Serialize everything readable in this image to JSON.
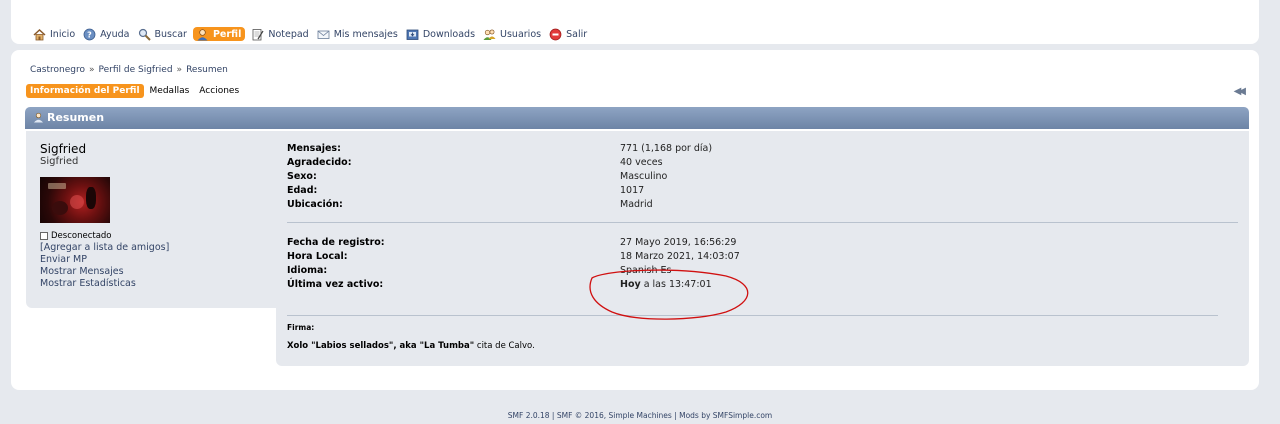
{
  "menu": {
    "items": [
      {
        "label": "Inicio",
        "icon": "home-icon"
      },
      {
        "label": "Ayuda",
        "icon": "help-icon"
      },
      {
        "label": "Buscar",
        "icon": "search-icon"
      },
      {
        "label": "Perfil",
        "icon": "profile-icon",
        "active": true
      },
      {
        "label": "Notepad",
        "icon": "notepad-icon"
      },
      {
        "label": "Mis mensajes",
        "icon": "mail-icon"
      },
      {
        "label": "Downloads",
        "icon": "downloads-icon"
      },
      {
        "label": "Usuarios",
        "icon": "users-icon"
      },
      {
        "label": "Salir",
        "icon": "logout-icon"
      }
    ]
  },
  "breadcrumb": {
    "items": [
      "Castronegro",
      "Perfil de Sigfried",
      "Resumen"
    ],
    "separator": "»"
  },
  "tabs": {
    "items": [
      "Información del Perfil",
      "Medallas",
      "Acciones"
    ],
    "collapse": "◀◀"
  },
  "section": {
    "title": "Resumen"
  },
  "profile": {
    "name": "Sigfried",
    "title": "Sigfried",
    "status": "Desconectado",
    "links": [
      "[Agregar a lista de amigos]",
      "Enviar MP",
      "Mostrar Mensajes",
      "Mostrar Estadísticas"
    ]
  },
  "details": {
    "group1": [
      {
        "label": "Mensajes:",
        "value": "771 (1,168 por día)"
      },
      {
        "label": "Agradecido:",
        "value": "40 veces"
      },
      {
        "label": "Sexo:",
        "value": "Masculino"
      },
      {
        "label": "Edad:",
        "value": "1017"
      },
      {
        "label": "Ubicación:",
        "value": "Madrid"
      }
    ],
    "group2": [
      {
        "label": "Fecha de registro:",
        "value": "27 Mayo 2019, 16:56:29"
      },
      {
        "label": "Hora Local:",
        "value": "18 Marzo 2021, 14:03:07"
      },
      {
        "label": "Idioma:",
        "value": "Spanish Es"
      },
      {
        "label": "Última vez activo:",
        "value_bold": "Hoy",
        "value": " a las 13:47:01"
      }
    ]
  },
  "signature": {
    "label": "Firma:",
    "text_bold": "Xolo \"Labios sellados\", aka \"La Tumba\"",
    "text_rest": " cita de Calvo."
  },
  "footer": {
    "text": "SMF 2.0.18 | SMF © 2016, Simple Machines | Mods by SMFSimple.com"
  },
  "colors": {
    "accent": "#f7941d",
    "link": "#334466",
    "annotation": "#d01010"
  }
}
